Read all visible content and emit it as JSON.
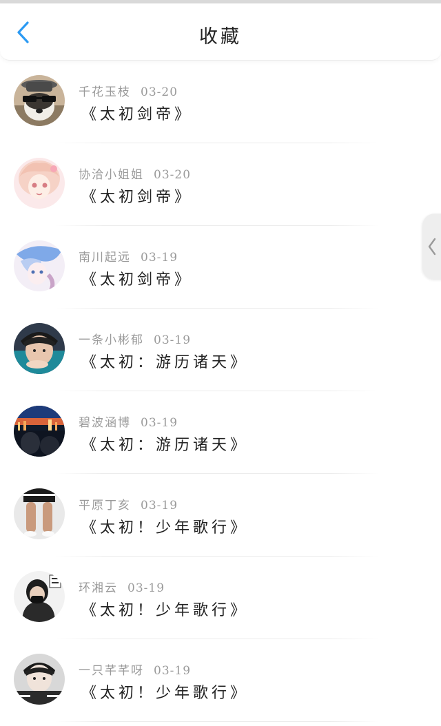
{
  "header": {
    "title": "收藏",
    "back_icon": "chevron-left-icon",
    "accent_color": "#2b9af3"
  },
  "side_handle": {
    "icon": "chevron-left-icon"
  },
  "favorites": [
    {
      "user": "千花玉枝",
      "time": "03-20",
      "book": "《太初剑帝》",
      "avatar": "dog-with-sunglasses-avatar"
    },
    {
      "user": "协洽小姐姐",
      "time": "03-20",
      "book": "《太初剑帝》",
      "avatar": "anime-girl-pink-avatar"
    },
    {
      "user": "南川起远",
      "time": "03-19",
      "book": "《太初剑帝》",
      "avatar": "anime-blue-hair-avatar"
    },
    {
      "user": "一条小彬郁",
      "time": "03-19",
      "book": "《太初：游历诸天》",
      "avatar": "boy-photo-avatar"
    },
    {
      "user": "碧波涵博",
      "time": "03-19",
      "book": "《太初：游历诸天》",
      "avatar": "city-night-avatar"
    },
    {
      "user": "平原丁亥",
      "time": "03-19",
      "book": "《太初！少年歌行》",
      "avatar": "legs-shorts-avatar"
    },
    {
      "user": "环湘云",
      "time": "03-19",
      "book": "《太初！少年歌行》",
      "avatar": "masked-person-avatar"
    },
    {
      "user": "一只芊芊呀",
      "time": "03-19",
      "book": "《太初！少年歌行》",
      "avatar": "boy-caption-avatar"
    }
  ]
}
